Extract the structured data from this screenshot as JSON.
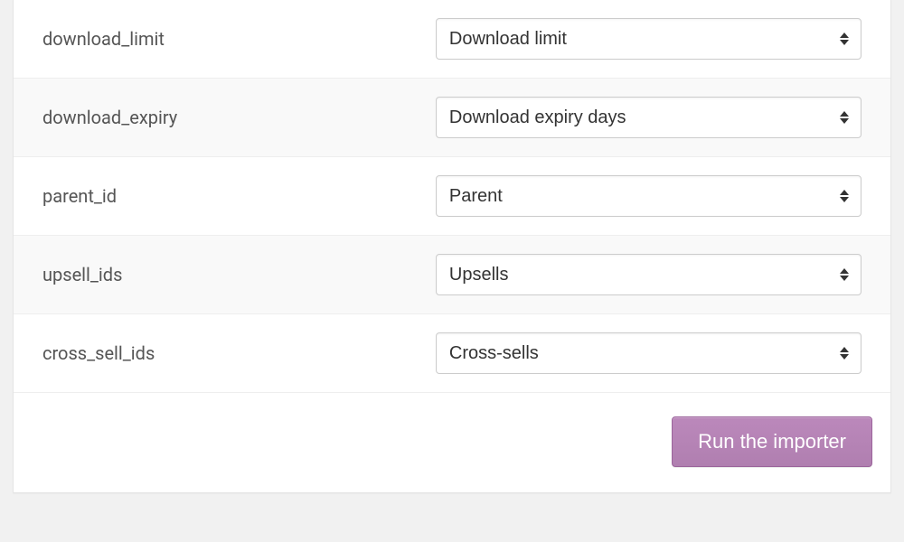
{
  "mapping": {
    "rows": [
      {
        "field": "download_limit",
        "selected": "Download limit"
      },
      {
        "field": "download_expiry",
        "selected": "Download expiry days"
      },
      {
        "field": "parent_id",
        "selected": "Parent"
      },
      {
        "field": "upsell_ids",
        "selected": "Upsells"
      },
      {
        "field": "cross_sell_ids",
        "selected": "Cross-sells"
      }
    ]
  },
  "actions": {
    "run_label": "Run the importer"
  },
  "colors": {
    "accent": "#b07fb0"
  }
}
